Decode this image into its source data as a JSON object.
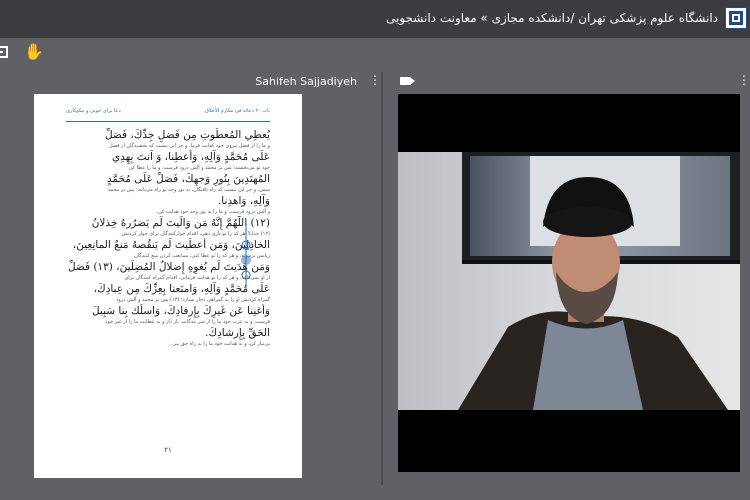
{
  "header": {
    "breadcrumb": "دانشگاه علوم پزشکی تهران /دانشکده مجازی » معاونت دانشجویی"
  },
  "toolbar": {
    "exit_icon": "exit-icon",
    "hand_icon": "raise-hand-icon"
  },
  "presentation": {
    "title": "Sahifeh Sajjadiyeh",
    "page": {
      "header_right": "باب ۲۰ دعائه فی مکارم الأخلاق",
      "header_left": "دعا برای خوبی و نیکوکاری",
      "lines": [
        {
          "t": "ar",
          "text": "يُعطِي المُعطُوتِ مِن فَضلِ جِدِّكَ، فَصَلِّ"
        },
        {
          "t": "fa",
          "text": "و ما را از فضل نیروی خود کفایت فرما، و جز این نیست که بخشندگان از فضل"
        },
        {
          "t": "ar",
          "text": "عَلَى مُحَمَّدٍ وَآلِهِ، وَأَعطِنا، وَ اَنتَ بِهِدِي"
        },
        {
          "t": "fa",
          "text": "خود تو می‌بخشند؛ پس بر محمد و آلش درود فرست، و ما را عطا کن"
        },
        {
          "t": "ar",
          "text": "المُهتَدِينَ بِنُورِ وَجهِكَ، فَصَلِّ عَلَى مُحَمَّدٍ"
        },
        {
          "t": "fa",
          "text": "بینش، و جز این نیست که راه یافتگان، به نور وجه تو راه می‌یابند؛ پس بر محمد"
        },
        {
          "t": "ar",
          "text": "وَآلِهِ، وَاهدِنا."
        },
        {
          "t": "fa",
          "text": "و آلش درود فرست، و ما را به نور وجه خود هدایت کن."
        },
        {
          "t": "ar",
          "text": "(۱۲) اللّهُمَّ إِنَّهُ مَن وَالَيتَ لَم يَضرُرهُ خِذلانُ"
        },
        {
          "t": "fa",
          "text": "(۱۲) خدایا! هر که را تو یاری دهی، اقدام خوارکنندگان برای خوار کردنش"
        },
        {
          "t": "ar",
          "text": "الخاذِلِينَ، وَمَن أَعطَيتَ لَم يَنقُصهُ مَنعُ المانِعِينَ،"
        },
        {
          "t": "fa",
          "text": "زیانش نرساند، و هر که را تو عطا کنی، ممانعت کردن منع کنندگان"
        },
        {
          "t": "ar",
          "text": "وَمَن هَدَيتَ لَم يُغوِهِ إِضلالُ المُضِلِّينَ، (۱۳) فَصَلِّ"
        },
        {
          "t": "fa",
          "text": "از او نمی‌کاهد، و هر که را تو هدایت فرمایی، اقدام گمراه کنندگان برای"
        },
        {
          "t": "ar",
          "text": "عَلَى مُحَمَّدٍ وَآلِهِ، وَامنَعنا بِعِزِّكَ مِن عِبادِكَ،"
        },
        {
          "t": "fa",
          "text": "گمراه کردنش او را به گمراهی دچار نسازد؛ (۱۳) پس بر محمد و آلش درود"
        },
        {
          "t": "ar",
          "text": "وَأَغنِنا عَن غَيرِكَ بِإِرفادِكَ، وَاسلُك بِنا سَبِيلَ"
        },
        {
          "t": "fa",
          "text": "فرست، و به عزت خود ما را از شر بندگانت باز دار و به عطایت ما را از غیر خود"
        },
        {
          "t": "ar",
          "text": "الحَقِّ بِإِرشادِكَ."
        },
        {
          "t": "fa",
          "text": "بی‌نیاز کن، و به هدایت خود ما را به راه حق ببر."
        }
      ],
      "page_number": "۲۱"
    }
  },
  "video": {
    "camera_icon": "camera-icon"
  },
  "colors": {
    "topbar": "#3c3d40",
    "background": "#5f6166",
    "accent": "#2a6fb2"
  }
}
